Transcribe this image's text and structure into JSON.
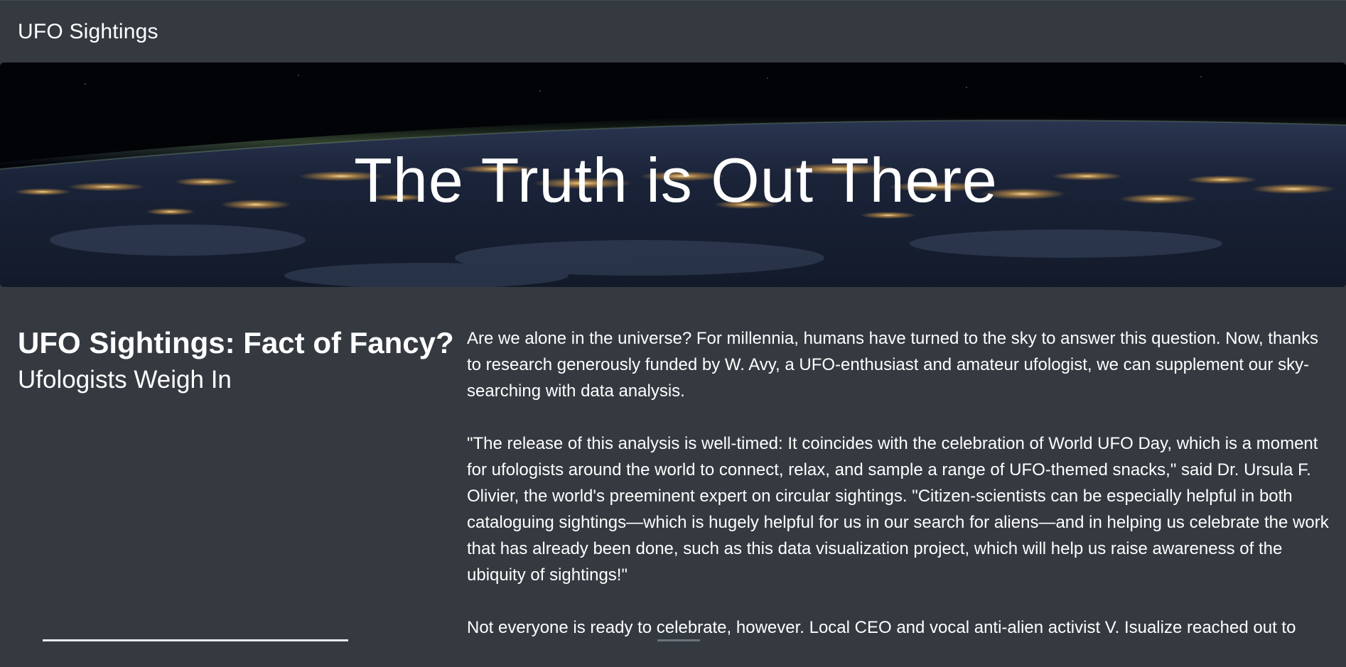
{
  "navbar": {
    "brand": "UFO Sightings"
  },
  "hero": {
    "title": "The Truth is Out There",
    "image": "earth-at-night-from-orbit"
  },
  "article": {
    "title": "UFO Sightings: Fact of Fancy?",
    "subtitle": "Ufologists Weigh In",
    "paragraphs": [
      "Are we alone in the universe? For millennia, humans have turned to the sky to answer this question. Now, thanks to research generously funded by W. Avy, a UFO-enthusiast and amateur ufologist, we can supplement our sky-searching with data analysis.",
      "\"The release of this analysis is well-timed: It coincides with the celebration of World UFO Day, which is a moment for ufologists around the world to connect, relax, and sample a range of UFO-themed snacks,\" said Dr. Ursula F. Olivier, the world's preeminent expert on circular sightings. \"Citizen-scientists can be especially helpful in both cataloguing sightings—which is hugely helpful for us in our search for aliens—and in helping us celebrate the work that has already been done, such as this data visualization project, which will help us raise awareness of the ubiquity of sightings!\"",
      "Not everyone is ready to celebrate, however. Local CEO and vocal anti-alien activist V. Isualize reached out to"
    ]
  },
  "colors": {
    "background": "#343a40",
    "text": "#ffffff",
    "city_lights": "#ffcf7a"
  }
}
